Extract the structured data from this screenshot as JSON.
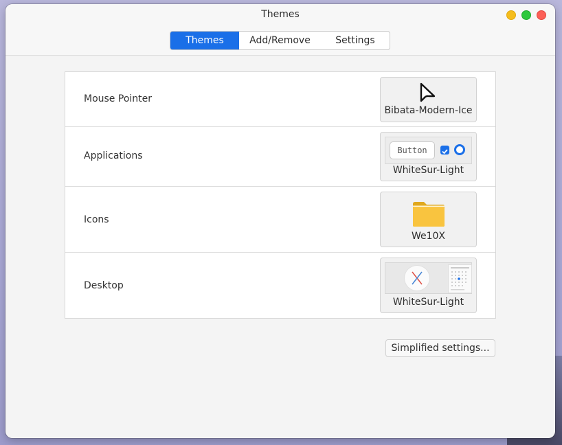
{
  "window": {
    "title": "Themes"
  },
  "tabs": [
    {
      "label": "Themes",
      "active": true
    },
    {
      "label": "Add/Remove",
      "active": false
    },
    {
      "label": "Settings",
      "active": false
    }
  ],
  "rows": [
    {
      "label": "Mouse Pointer",
      "theme": "Bibata-Modern-Ice",
      "preview_icon": "cursor-arrow-icon"
    },
    {
      "label": "Applications",
      "theme": "WhiteSur-Light",
      "preview_button": "Button",
      "preview_icon": "widget-preview"
    },
    {
      "label": "Icons",
      "theme": "We10X",
      "preview_icon": "folder-icon"
    },
    {
      "label": "Desktop",
      "theme": "WhiteSur-Light",
      "preview_icon": "desktop-preview"
    }
  ],
  "simplified_button": "Simplified settings...",
  "colors": {
    "accent": "#1a6fe8",
    "folder": "#f9c43f",
    "close": "#fc5f57",
    "minimize": "#f5bd1d",
    "maximize": "#2dc83c"
  }
}
